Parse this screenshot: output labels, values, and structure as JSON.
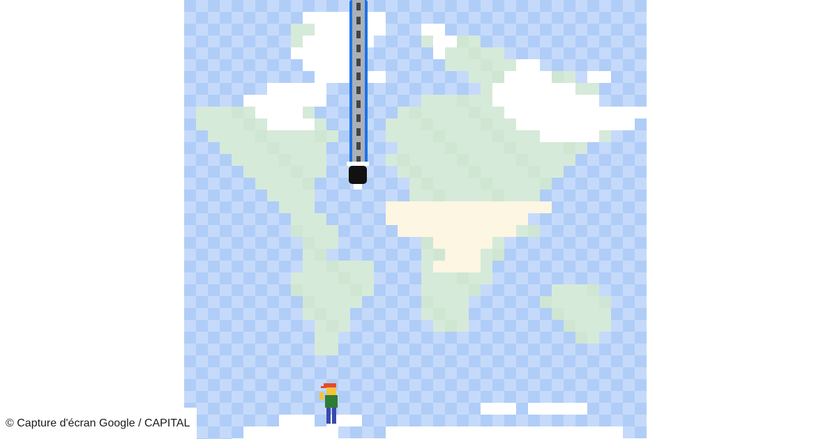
{
  "caption": {
    "credit": "© Capture d'écran Google / CAPITAL"
  },
  "game": {
    "scene": "pixel world map",
    "colors": {
      "ocean_light": "#c5dafa",
      "ocean_dark": "#b0cdf7",
      "land": "#d6ead9",
      "land_alt": "#cfe6d2",
      "ice": "#ffffff",
      "desert": "#fcf6e3",
      "cable": "#a9b0b8",
      "cable_border": "#1a73e8",
      "cable_dash": "#444444",
      "drill_head": "#111111",
      "player_hat": "#e34b2f",
      "player_skin": "#f5c33b",
      "player_shirt": "#2e7d32",
      "player_pants": "#3949ab"
    },
    "icons": [
      "drill-cable",
      "drill-head-icon",
      "player-character-icon"
    ]
  }
}
